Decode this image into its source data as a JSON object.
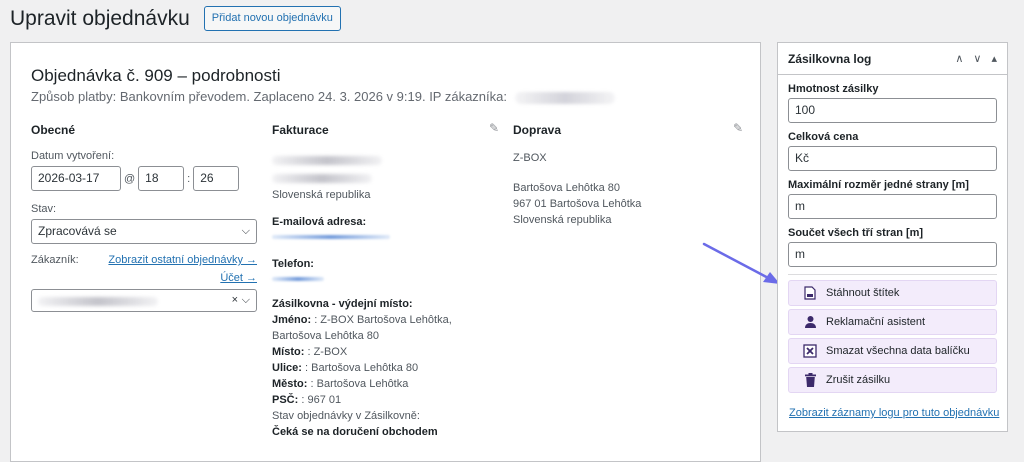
{
  "header": {
    "title": "Upravit objednávku",
    "add_button": "Přidat novou objednávku"
  },
  "order": {
    "heading": "Objednávka č. 909 – podrobnosti",
    "meta": "Způsob platby: Bankovním převodem. Zaplaceno 24. 3. 2026 v 9:19. IP zákazníka:"
  },
  "general": {
    "title": "Obecné",
    "date_label": "Datum vytvoření:",
    "date": "2026-03-17",
    "at": "@",
    "hour": "18",
    "colon": ":",
    "minute": "26",
    "status_label": "Stav:",
    "status": "Zpracovává se",
    "customer_label": "Zákazník:",
    "other_orders_link": "Zobrazit ostatní objednávky →",
    "account_link": "Účet →"
  },
  "billing": {
    "title": "Fakturace",
    "country": "Slovenská republika",
    "email_label": "E-mailová adresa:",
    "phone_label": "Telefon:",
    "pickup_title": "Zásilkovna - výdejní místo:",
    "name_label": "Jméno:",
    "name_value": ": Z-BOX Bartošova Lehôtka, Bartošova Lehôtka 80",
    "place_label": "Místo:",
    "place_value": ": Z-BOX",
    "street_label": "Ulice:",
    "street_value": ": Bartošova Lehôtka 80",
    "city_label": "Město:",
    "city_value": ": Bartošova Lehôtka",
    "zip_label": "PSČ:",
    "zip_value": ": 967 01",
    "state_label": "Stav objednávky v Zásilkovně:",
    "state_value": "Čeká se na doručení obchodem"
  },
  "shipping": {
    "title": "Doprava",
    "line1": "Z-BOX",
    "line2": "Bartošova Lehôtka 80",
    "line3": "967 01 Bartošova Lehôtka",
    "line4": "Slovenská republika"
  },
  "log_panel": {
    "title": "Zásilkovna log",
    "weight_label": "Hmotnost zásilky",
    "weight_value": "100",
    "price_label": "Celková cena",
    "price_placeholder": "Kč",
    "max_dim_label": "Maximální rozměr jedné strany [m]",
    "max_dim_placeholder": "m",
    "sum_dim_label": "Součet všech tří stran [m]",
    "sum_dim_placeholder": "m",
    "actions": [
      {
        "label": "Stáhnout štítek",
        "icon": "pdf-icon"
      },
      {
        "label": "Reklamační asistent",
        "icon": "user-icon"
      },
      {
        "label": "Smazat všechna data balíčku",
        "icon": "delete-box-icon"
      },
      {
        "label": "Zrušit zásilku",
        "icon": "trash-icon"
      }
    ],
    "log_link": "Zobrazit záznamy logu pro tuto objednávku"
  },
  "colors": {
    "accent": "#2271b1",
    "action_bg": "#f3ecfb",
    "arrow": "#6b6be8",
    "action_icon": "#3c2a6b"
  }
}
